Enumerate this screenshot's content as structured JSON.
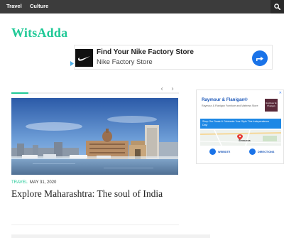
{
  "nav": {
    "links": [
      "Travel",
      "Culture"
    ],
    "search_icon": "search-icon"
  },
  "brand": "WitsAdda",
  "ad_top": {
    "headline": "Find Your Nike Factory Store",
    "subline": "Nike Factory Store",
    "logo_icon": "nike-swoosh-icon",
    "cta_icon": "directions-arrow-icon",
    "cta_color": "#1a73e8"
  },
  "slider": {
    "prev_label": "‹",
    "next_label": "›",
    "progress": 0.1
  },
  "post": {
    "category": "TRAVEL",
    "date": "MAY 31, 2020",
    "title": "Explore Maharashtra: The soul of India"
  },
  "ad_side": {
    "advertiser": "Raymour & Flanigan®",
    "tagline": "Raymour & Flanigan Furniture and Mattress Store",
    "logo_text": "Raymour & Flanigan",
    "promo": "Shop Our Deals & Celebrate Your Style This Independence Day!",
    "map_label": "Secaucus",
    "website_label": "WEBSITE",
    "directions_label": "DIRECTIONS",
    "close_label": "✕"
  },
  "colors": {
    "accent": "#20c997",
    "nav_bg": "#3c3c3c"
  }
}
